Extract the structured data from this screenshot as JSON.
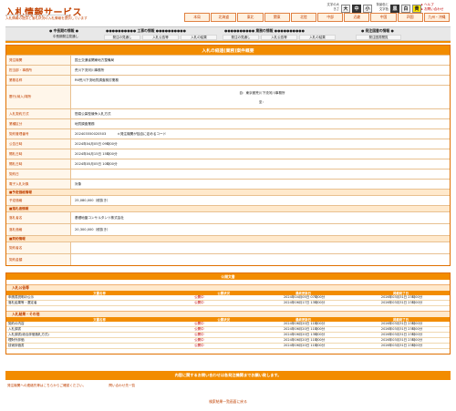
{
  "header": {
    "title": "入札情報サービス",
    "subtitle": "入札情報の提供と落札状況の入札情報を提供しています",
    "font_size_label": "文字の大きさ",
    "font_buttons": [
      "大",
      "中",
      "小"
    ],
    "contrast_label": "背景色と文字色",
    "contrast_buttons": [
      "黒",
      "白",
      "黄"
    ],
    "help": "ヘルプ",
    "inquiry": "お問い合わせ",
    "regions": [
      "本局",
      "北海道",
      "東北",
      "関東",
      "北陸",
      "中部",
      "近畿",
      "中国",
      "四国",
      "九州・沖縄"
    ]
  },
  "nav": {
    "groups": [
      {
        "title": "● 中長期の情報 ●",
        "links": [
          "中長期発注見通し"
        ]
      },
      {
        "title": "●●●●●●●●●● 工事の情報 ●●●●●●●●●●",
        "links": [
          "発注の見通し",
          "入札公告等",
          "入札の結果"
        ]
      },
      {
        "title": "●●●●●●●●●● 業務の情報 ●●●●●●●●●●",
        "links": [
          "発注の見通し",
          "入札公告等",
          "入札の結果"
        ]
      },
      {
        "title": "● 発注図書の情報 ●",
        "links": [
          "発注図書閲覧"
        ]
      }
    ]
  },
  "detail": {
    "title": "入札の経過(業務)案件概要",
    "rows": [
      {
        "k": "発注機関",
        "v": "国土交通省関東地方整備局"
      },
      {
        "k": "担当部・事務所",
        "v": "荒川下流河川事務所"
      },
      {
        "k": "業務名称",
        "v": "R6荒川下流地質調査検討業務"
      },
      {
        "k": "履行(納入)場所",
        "v": "自：東京都荒川下流河川事務所",
        "v2": "至："
      },
      {
        "k": "入札契約方式",
        "v": "簡易公募型競争入札方式"
      },
      {
        "k": "業種区分",
        "v": "地質調査業務"
      },
      {
        "k": "契約管理番号",
        "v": "202403550020503",
        "note": "＊発注機関が独自に定めるコード"
      },
      {
        "k": "公告日時",
        "v": "2024年04月05日 09時00分"
      },
      {
        "k": "開札日時",
        "v": "2024年04月15日 15時00分"
      },
      {
        "k": "開札日時",
        "v": "2024年05月05日 10時00分"
      },
      {
        "k": "契約日",
        "v": ""
      },
      {
        "k": "電子入札対象",
        "v": "対象"
      }
    ],
    "section_price": "■予定価格情報",
    "price_rows": [
      {
        "k": "予定価格",
        "v": "25,080,000（税抜き）"
      }
    ],
    "section_winner": "■落札者情報",
    "winner_rows": [
      {
        "k": "落札者名",
        "v": "基礎地盤コンサルタンツ株式会社"
      },
      {
        "k": "落札価格",
        "v": "20,300,000（税抜き）"
      }
    ],
    "section_contract": "■契約情報",
    "contract_rows": [
      {
        "k": "契約者名",
        "v": ""
      },
      {
        "k": "契約金額",
        "v": ""
      }
    ]
  },
  "publications": {
    "heading": "公開文書",
    "groups": [
      {
        "title": "入札公告等",
        "headers": [
          "文書名称",
          "公開状況",
          "最終更新日",
          "掲載終了日"
        ],
        "rows": [
          [
            "申請書説明の公示",
            "公開中",
            "2024年04月05日 07時00分",
            "2026年03月31日 23時00分"
          ],
          [
            "落札結果等・選定者",
            "公開中",
            "2024年06月17日 13時00分",
            "2026年03月31日 23時00分"
          ]
        ]
      },
      {
        "title": "入札結果・その他",
        "headers": [
          "文書名称",
          "公開状況",
          "最終更新日",
          "掲載終了日"
        ],
        "rows": [
          [
            "契約の内容",
            "公開中",
            "2024年06月20日 11時00分",
            "2026年03月31日 23時00分"
          ],
          [
            "入札調書",
            "公開中",
            "2024年06月20日 11時00分",
            "2026年03月31日 23時00分"
          ],
          [
            "入札調書(総合評価落札方式)",
            "公開中",
            "2024年06月20日 13時00分",
            "2026年03月31日 23時00分"
          ],
          [
            "理財外評価",
            "公開中",
            "2024年06月20日 11時00分",
            "2026年03月31日 23時00分"
          ],
          [
            "技術評価書",
            "公開中",
            "2024年06月20日 11時00分",
            "2026年03月31日 23時00分"
          ]
        ]
      }
    ]
  },
  "footer": {
    "notice": "内容に関するお問い合わせは各発注機関までお願い致します。",
    "links": [
      "発注機関への連絡先等はこちらからご確認ください。",
      "問い合わせ先一覧"
    ],
    "back": "検索結果一覧画面に戻る"
  },
  "colors": {
    "accent": "#f28c00",
    "brand_text": "#c04000",
    "status_public": "#c00000"
  }
}
